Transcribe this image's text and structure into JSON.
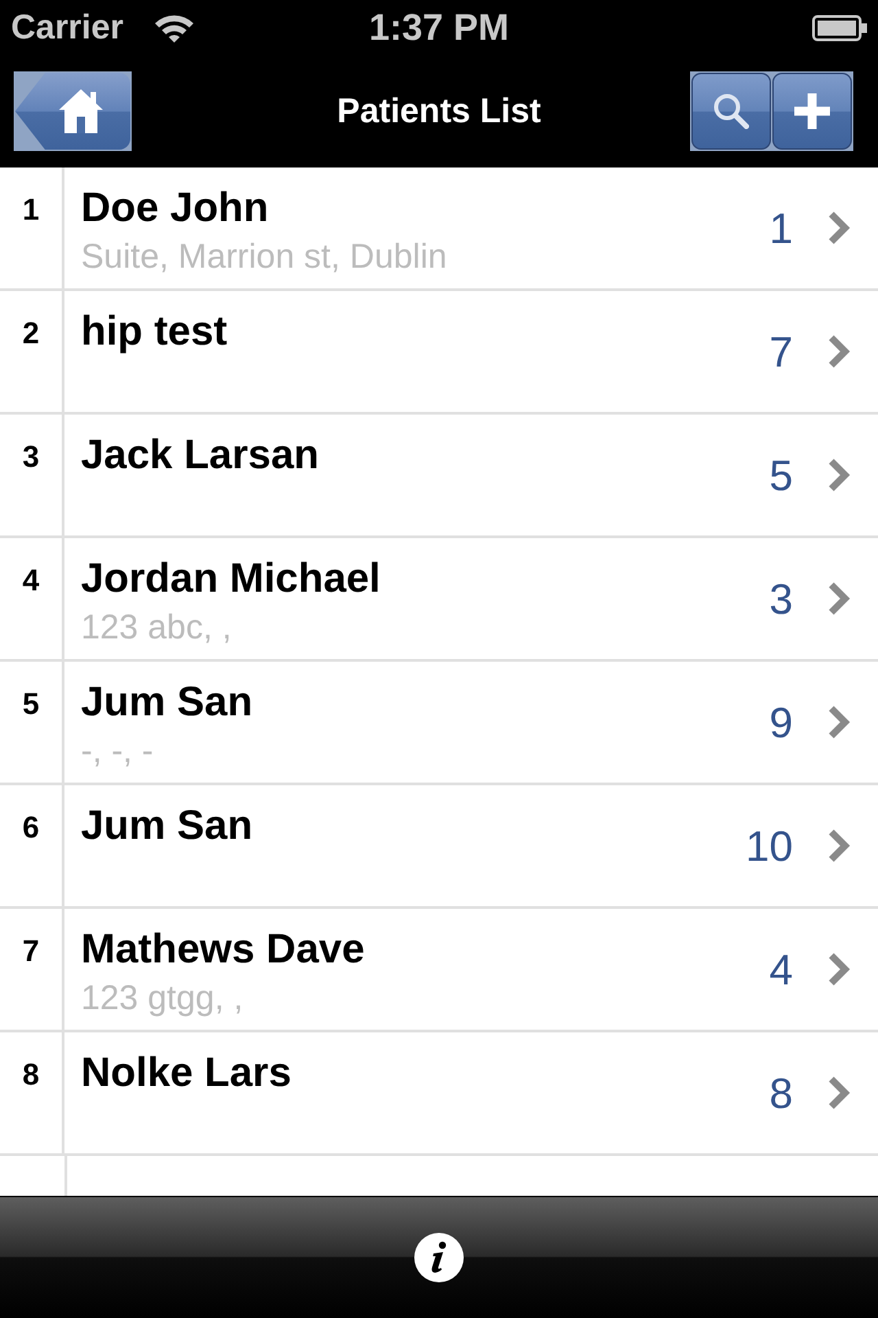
{
  "status_bar": {
    "carrier": "Carrier",
    "time": "1:37 PM"
  },
  "nav_bar": {
    "title": "Patients List"
  },
  "patients": [
    {
      "index": "1",
      "name": "Doe John",
      "address": "Suite, Marrion st, Dublin",
      "count": "1"
    },
    {
      "index": "2",
      "name": "hip test",
      "count": "7"
    },
    {
      "index": "3",
      "name": "Jack Larsan",
      "count": "5"
    },
    {
      "index": "4",
      "name": "Jordan Michael",
      "address": "123 abc, ,",
      "count": "3"
    },
    {
      "index": "5",
      "name": "Jum San",
      "address": "-, -, -",
      "count": "9"
    },
    {
      "index": "6",
      "name": "Jum San",
      "count": "10"
    },
    {
      "index": "7",
      "name": "Mathews Dave",
      "address": "123 gtgg, ,",
      "count": "4"
    },
    {
      "index": "8",
      "name": "Nolke Lars",
      "count": "8"
    }
  ]
}
